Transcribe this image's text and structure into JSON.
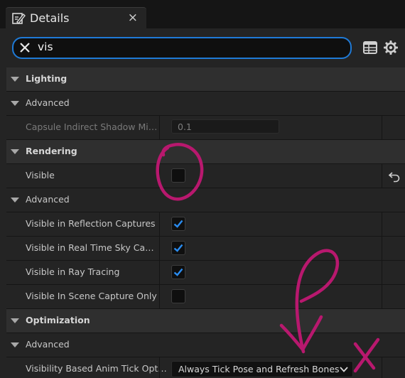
{
  "tab": {
    "title": "Details",
    "close_glyph": "×",
    "icon": "pencil-details-icon"
  },
  "search": {
    "value": "vis",
    "clear_icon": "close-icon"
  },
  "toolbar": {
    "table_icon": "table-view-icon",
    "settings_icon": "gear-icon"
  },
  "lighting": {
    "label": "Lighting",
    "advanced": "Advanced",
    "capsule_label": "Capsule Indirect Shadow Min...",
    "capsule_value": "0.1"
  },
  "rendering": {
    "label": "Rendering",
    "visible_label": "Visible",
    "visible_checked": false,
    "advanced": "Advanced",
    "props": [
      {
        "label": "Visible in Reflection Captures",
        "checked": true
      },
      {
        "label": "Visible in Real Time Sky Captur...",
        "checked": true
      },
      {
        "label": "Visible in Ray Tracing",
        "checked": true
      },
      {
        "label": "Visible In Scene Capture Only",
        "checked": false
      }
    ]
  },
  "optimization": {
    "label": "Optimization",
    "advanced": "Advanced",
    "anim_tick_label": "Visibility Based Anim Tick Option",
    "anim_tick_value": "Always Tick Pose and Refresh Bones"
  },
  "colors": {
    "accent": "#1f7ad6",
    "annotation": "#b8186e"
  }
}
